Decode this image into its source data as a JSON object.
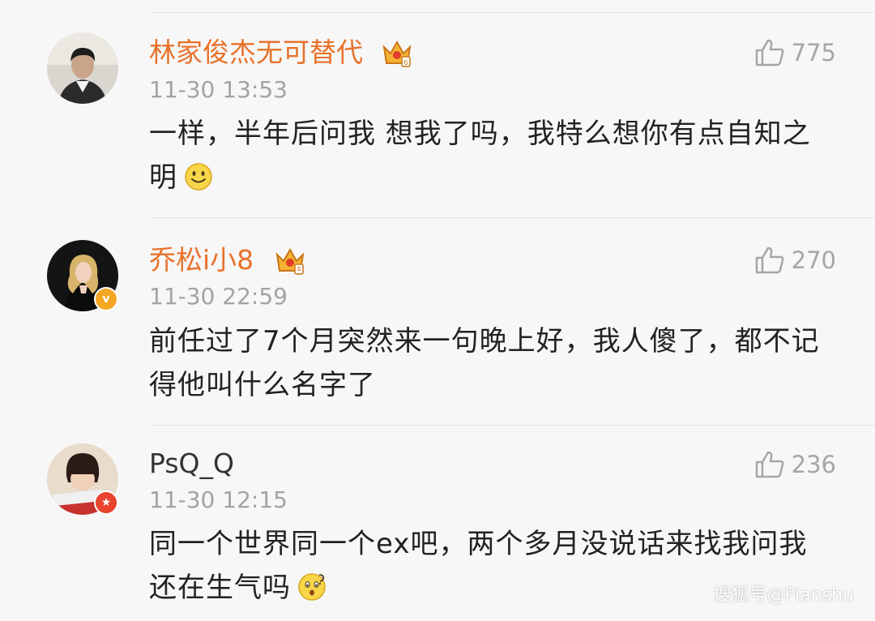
{
  "comments": [
    {
      "username": "林家俊杰无可替代",
      "timestamp": "11-30 13:53",
      "likes": "775",
      "text": "一样，半年后问我 想我了吗，我特么想你有点自知之明",
      "emoji": "smile-emoji"
    },
    {
      "username": "乔松i小8",
      "timestamp": "11-30 22:59",
      "likes": "270",
      "text": "前任过了7个月突然来一句晚上好，我人傻了，都不记得他叫什么名字了"
    },
    {
      "username": "PsQ_Q",
      "timestamp": "11-30 12:15",
      "likes": "236",
      "text": "同一个世界同一个ex吧，两个多月没说话来找我问我还在生气吗",
      "emoji": "confused-emoji"
    }
  ],
  "watermark": "搜狐号@Pianshu",
  "colors": {
    "vip_name": "#e8722b",
    "normal_name": "#333333",
    "meta": "#a3a3a3",
    "background": "#f7f7f7"
  }
}
